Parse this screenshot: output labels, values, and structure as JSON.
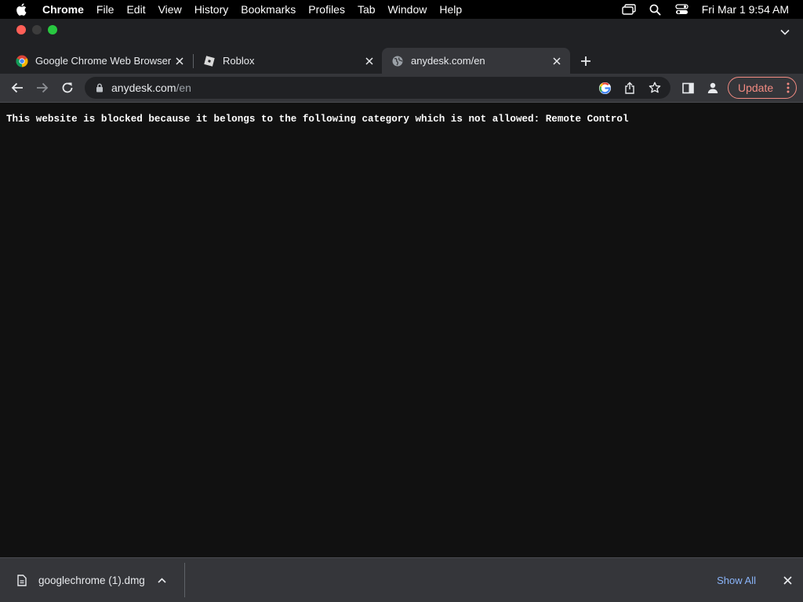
{
  "menubar": {
    "app_name": "Chrome",
    "items": [
      "File",
      "Edit",
      "View",
      "History",
      "Bookmarks",
      "Profiles",
      "Tab",
      "Window",
      "Help"
    ],
    "clock": "Fri Mar 1  9:54 AM"
  },
  "tabs": [
    {
      "title": "Google Chrome Web Browser",
      "favicon": "chrome-logo-icon"
    },
    {
      "title": "Roblox",
      "favicon": "roblox-logo-icon"
    },
    {
      "title": "anydesk.com/en",
      "favicon": "globe-icon",
      "active": true
    }
  ],
  "omnibox": {
    "host": "anydesk.com",
    "path": "/en"
  },
  "toolbar": {
    "update_label": "Update"
  },
  "page": {
    "message": "This website is blocked because it belongs to the following category which is not allowed: Remote Control"
  },
  "downloads": {
    "file_name": "googlechrome (1).dmg",
    "show_all_label": "Show All"
  },
  "colors": {
    "menubar": "#000000",
    "tabstrip": "#202124",
    "toolbar": "#35363a",
    "page_bg": "#111111",
    "update_accent": "#f28b82",
    "link": "#8ab4f8"
  }
}
